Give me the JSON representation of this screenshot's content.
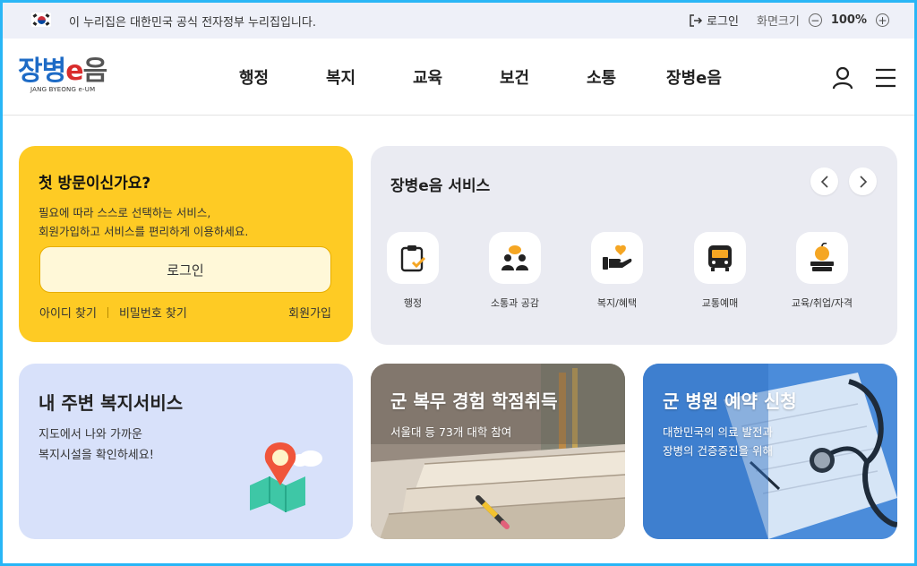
{
  "gov_bar": {
    "notice": "이 누리집은 대한민국 공식 전자정부 누리집입니다.",
    "login": "로그인",
    "zoom_label": "화면크기",
    "zoom_value": "100%",
    "zoom_out_symbol": "−",
    "zoom_in_symbol": "+"
  },
  "header": {
    "logo": {
      "part1": "장병",
      "part2": "e",
      "part3": "음",
      "subtitle": "JANG BYEONG e-UM"
    },
    "nav": [
      "행정",
      "복지",
      "교육",
      "보건",
      "소통",
      "장병e음"
    ]
  },
  "first_visit": {
    "title": "첫 방문이신가요?",
    "desc_line1": "필요에 따라 스스로 선택하는 서비스,",
    "desc_line2": "회원가입하고 서비스를 편리하게 이용하세요.",
    "login_button": "로그인",
    "find_id": "아이디 찾기",
    "find_password": "비밀번호 찾기",
    "join": "회원가입"
  },
  "services": {
    "title": "장병e음 서비스",
    "items": [
      {
        "label": "행정",
        "icon": "clipboard-check-icon"
      },
      {
        "label": "소통과 공감",
        "icon": "people-chat-icon"
      },
      {
        "label": "복지/혜택",
        "icon": "hand-heart-icon"
      },
      {
        "label": "교통예매",
        "icon": "bus-icon"
      },
      {
        "label": "교육/취업/자격",
        "icon": "apple-books-icon"
      }
    ]
  },
  "welfare": {
    "title": "내 주변 복지서비스",
    "desc_line1": "지도에서 나와 가까운",
    "desc_line2": "복지시설을 확인하세요!"
  },
  "military_credit": {
    "title": "군 복무 경험 학점취득",
    "desc": "서울대 등 73개 대학 참여"
  },
  "hospital": {
    "title": "군 병원 예약 신청",
    "desc_line1": "대한민국의 의료 발전과",
    "desc_line2": "장병의 건증증진을 위해"
  },
  "colors": {
    "first_visit_bg": "#fecb24",
    "services_bg": "#eaebf2",
    "welfare_bg": "#d8e1fa",
    "accent_orange": "#f5a623"
  }
}
